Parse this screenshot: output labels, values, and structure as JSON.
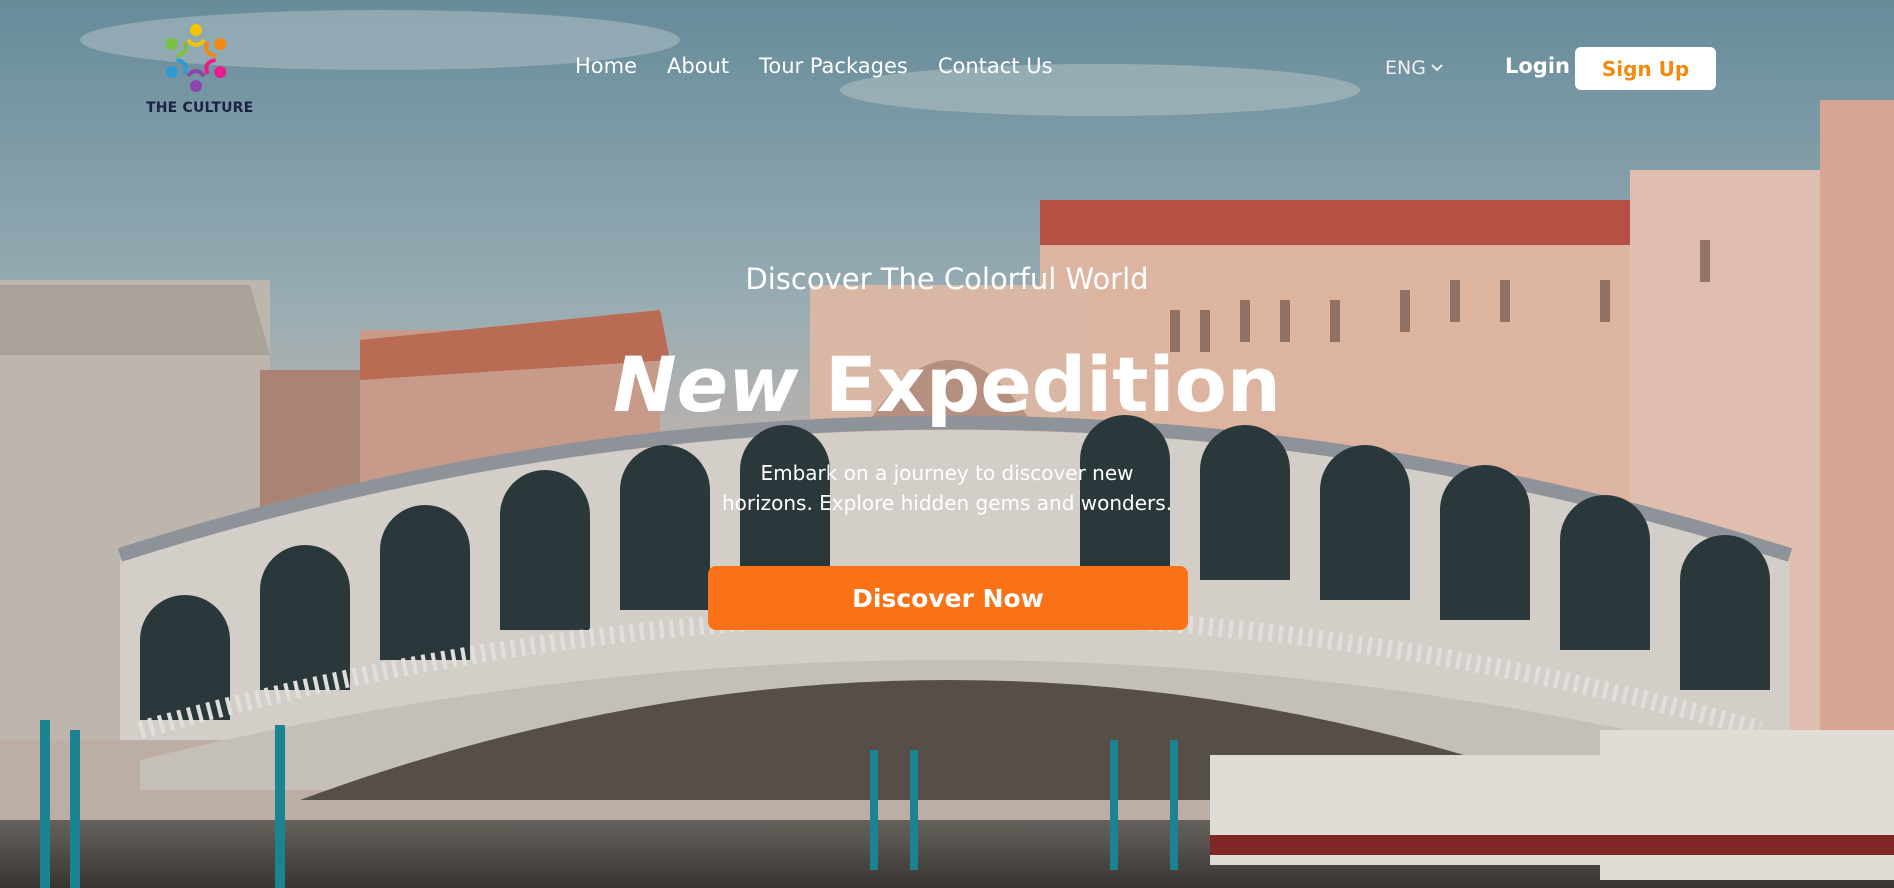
{
  "brand": {
    "name": "THE CULTURE",
    "logo_icon": "people-circle-logo",
    "logo_colors": [
      "#f5c400",
      "#f28a0f",
      "#e91e8c",
      "#8e44ad",
      "#2e9ad0",
      "#7ac142"
    ]
  },
  "nav": {
    "items": [
      {
        "label": "Home"
      },
      {
        "label": "About"
      },
      {
        "label": "Tour Packages"
      },
      {
        "label": "Contact Us"
      }
    ]
  },
  "header": {
    "language": "ENG",
    "language_icon": "chevron-down-icon",
    "login_label": "Login",
    "signup_label": "Sign Up"
  },
  "hero": {
    "eyebrow": "Discover The Colorful World",
    "headline_italic": "New",
    "headline_rest": "Expedition",
    "subtitle_line1": "Embark on a journey to discover new",
    "subtitle_line2": "horizons. Explore hidden gems and wonders.",
    "cta_label": "Discover Now",
    "background_image": "Rialto Bridge over the Grand Canal, Venice"
  },
  "colors": {
    "accent": "#f97316",
    "signup_text": "#f28a0f",
    "brand_text": "#1a2344"
  }
}
